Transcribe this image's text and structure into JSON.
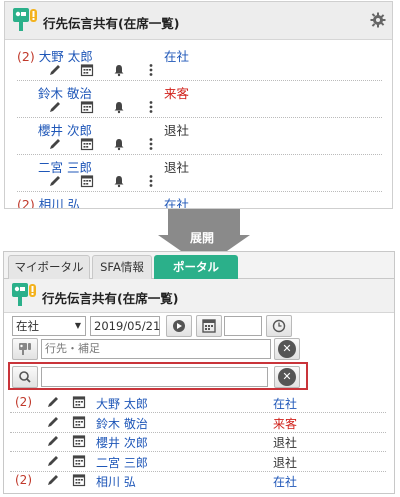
{
  "top_panel": {
    "title": "行先伝言共有(在席一覧)",
    "rows": [
      {
        "count": "(2)",
        "name": "大野 太郎",
        "status": "在社",
        "status_color": "blue"
      },
      {
        "count": "",
        "name": "鈴木 敬治",
        "status": "来客",
        "status_color": "red"
      },
      {
        "count": "",
        "name": "櫻井 次郎",
        "status": "退社",
        "status_color": "dark"
      },
      {
        "count": "",
        "name": "二宮 三郎",
        "status": "退社",
        "status_color": "dark"
      },
      {
        "count": "(2)",
        "name": "相川 弘",
        "status": "在社",
        "status_color": "blue"
      }
    ]
  },
  "expand_label": "展開",
  "bottom_panel": {
    "tabs": [
      {
        "label": "マイポータル"
      },
      {
        "label": "SFA情報"
      },
      {
        "label": "ポータル"
      }
    ],
    "title": "行先伝言共有(在席一覧)",
    "filter": {
      "status_selected": "在社",
      "date_value": "2019/05/21",
      "note_placeholder": "行先・補足",
      "search_value": ""
    },
    "rows": [
      {
        "count": "(2)",
        "name": "大野 太郎",
        "status": "在社",
        "status_color": "blue"
      },
      {
        "count": "",
        "name": "鈴木 敬治",
        "status": "来客",
        "status_color": "red"
      },
      {
        "count": "",
        "name": "櫻井 次郎",
        "status": "退社",
        "status_color": "dark"
      },
      {
        "count": "",
        "name": "二宮 三郎",
        "status": "退社",
        "status_color": "dark"
      },
      {
        "count": "(2)",
        "name": "相川 弘",
        "status": "在社",
        "status_color": "blue"
      }
    ]
  },
  "colors": {
    "accent": "#2bb08a",
    "link": "#1f57b8",
    "alert": "#d0201a",
    "count": "#c0392b",
    "highlight": "#c9343a"
  }
}
